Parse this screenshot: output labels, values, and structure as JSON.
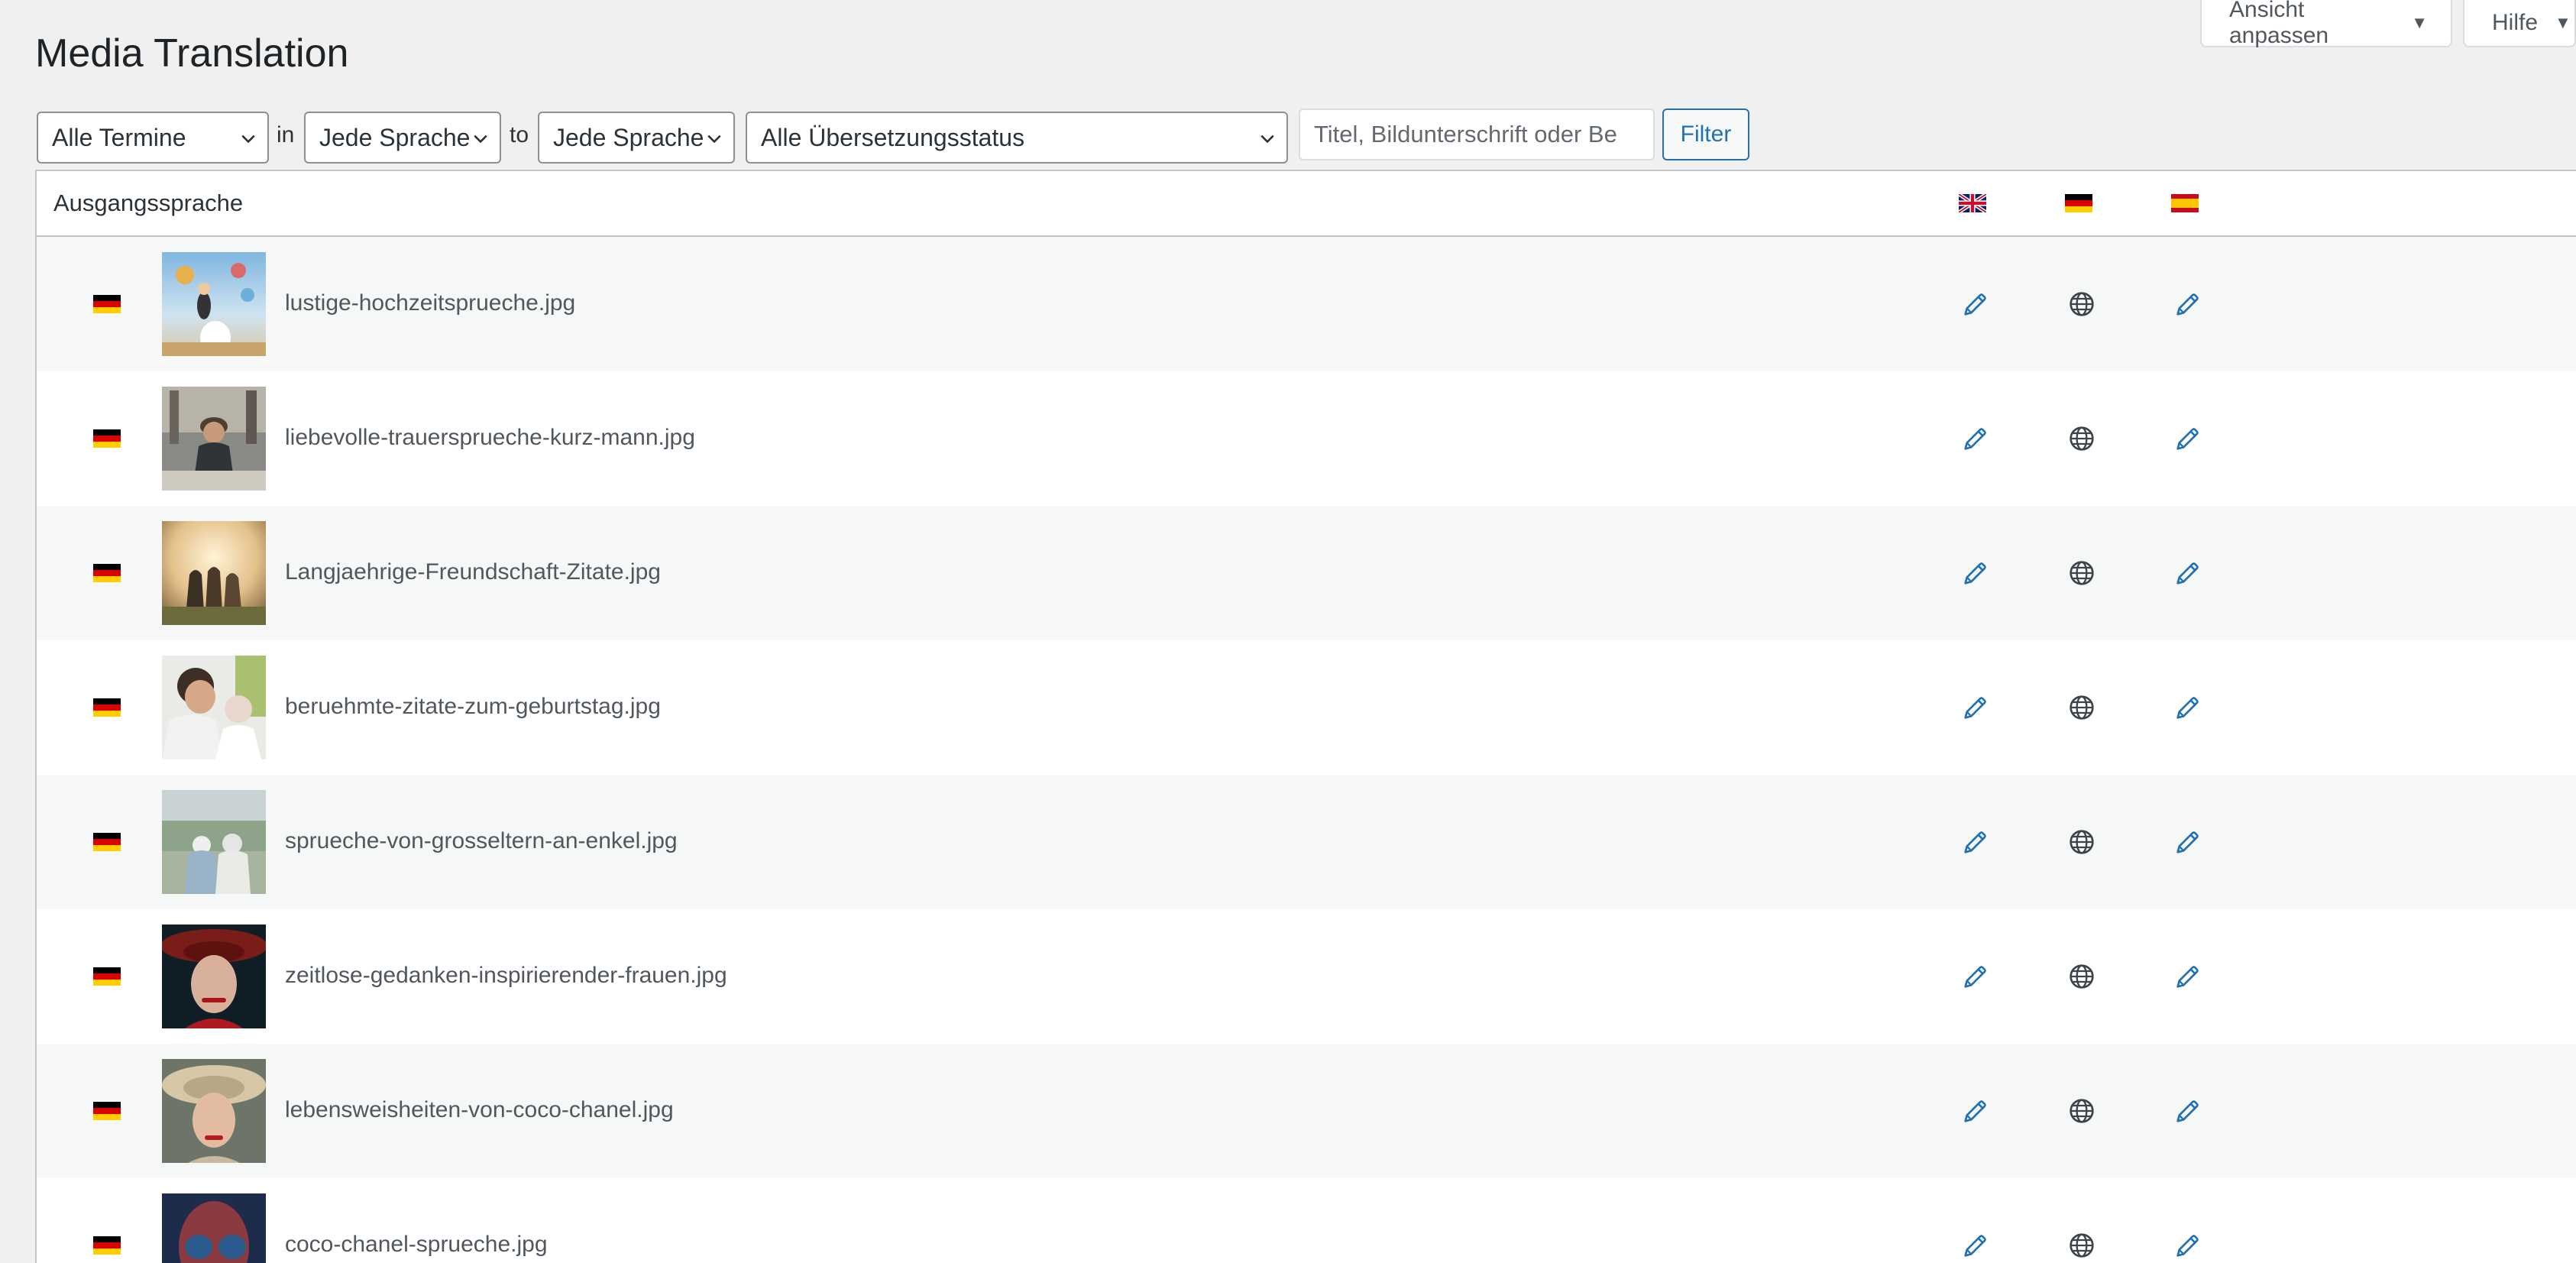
{
  "screen_meta": {
    "ansicht_label": "Ansicht anpassen",
    "hilfe_label": "Hilfe"
  },
  "page": {
    "title": "Media Translation"
  },
  "filters": {
    "date_select": "Alle Termine",
    "conj_in": "in",
    "source_lang_select": "Jede Sprache",
    "conj_to": "to",
    "target_lang_select": "Jede Sprache",
    "status_select": "Alle Übersetzungsstatus",
    "search_placeholder": "Titel, Bildunterschrift oder Be",
    "filter_button": "Filter"
  },
  "table": {
    "header_label": "Ausgangssprache",
    "language_columns": [
      {
        "icon": "flag-gb-icon"
      },
      {
        "icon": "flag-de-icon"
      },
      {
        "icon": "flag-es-icon"
      }
    ],
    "rows": [
      {
        "source_flag": "flag-de-icon",
        "filename": "lustige-hochzeitsprueche.jpg",
        "actions": [
          "pencil-icon",
          "globe-icon",
          "pencil-icon"
        ]
      },
      {
        "source_flag": "flag-de-icon",
        "filename": "liebevolle-trauersprueche-kurz-mann.jpg",
        "actions": [
          "pencil-icon",
          "globe-icon",
          "pencil-icon"
        ]
      },
      {
        "source_flag": "flag-de-icon",
        "filename": "Langjaehrige-Freundschaft-Zitate.jpg",
        "actions": [
          "pencil-icon",
          "globe-icon",
          "pencil-icon"
        ]
      },
      {
        "source_flag": "flag-de-icon",
        "filename": "beruehmte-zitate-zum-geburtstag.jpg",
        "actions": [
          "pencil-icon",
          "globe-icon",
          "pencil-icon"
        ]
      },
      {
        "source_flag": "flag-de-icon",
        "filename": "sprueche-von-grosseltern-an-enkel.jpg",
        "actions": [
          "pencil-icon",
          "globe-icon",
          "pencil-icon"
        ]
      },
      {
        "source_flag": "flag-de-icon",
        "filename": "zeitlose-gedanken-inspirierender-frauen.jpg",
        "actions": [
          "pencil-icon",
          "globe-icon",
          "pencil-icon"
        ]
      },
      {
        "source_flag": "flag-de-icon",
        "filename": "lebensweisheiten-von-coco-chanel.jpg",
        "actions": [
          "pencil-icon",
          "globe-icon",
          "pencil-icon"
        ]
      },
      {
        "source_flag": "flag-de-icon",
        "filename": "coco-chanel-sprueche.jpg",
        "actions": [
          "pencil-icon",
          "globe-icon",
          "pencil-icon"
        ]
      }
    ]
  },
  "colors": {
    "accent": "#2271b1",
    "background": "#f0f0f1",
    "row_alt": "#f6f7f7"
  }
}
